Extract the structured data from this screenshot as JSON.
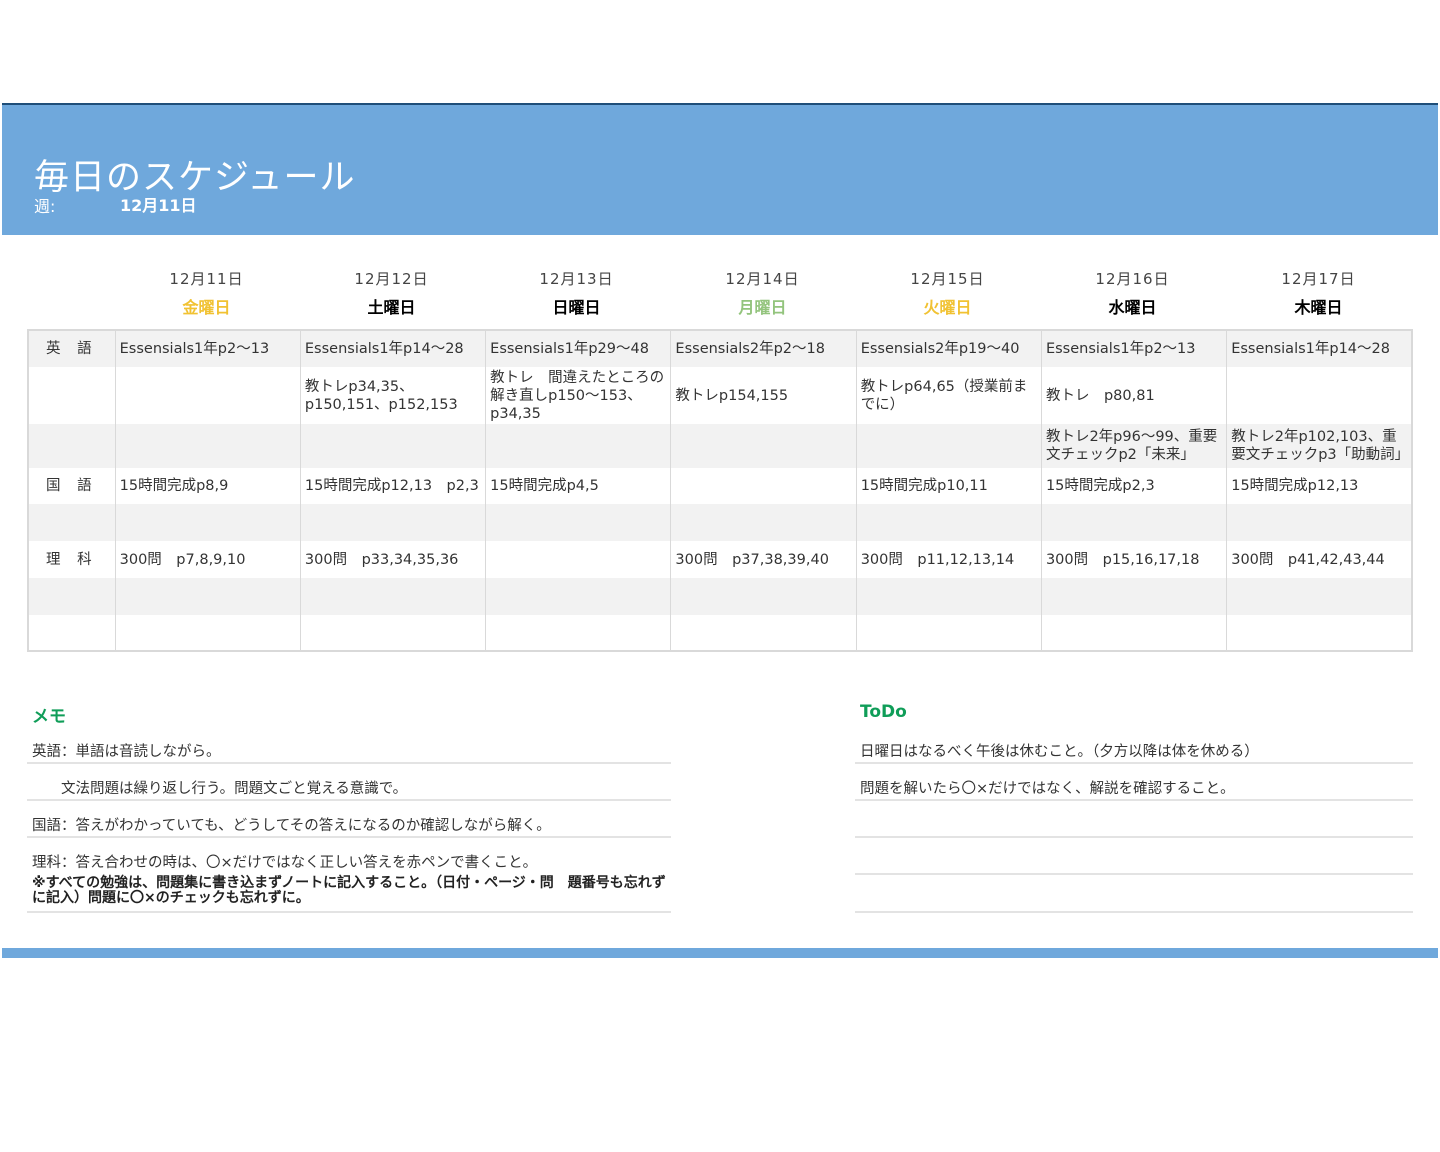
{
  "header": {
    "title": "毎日のスケジュール",
    "week_label": "週:",
    "week_value": "12月11日"
  },
  "days": [
    {
      "date": "12月11日",
      "name": "金曜日",
      "color": "#f1c232"
    },
    {
      "date": "12月12日",
      "name": "土曜日",
      "color": "#000000"
    },
    {
      "date": "12月13日",
      "name": "日曜日",
      "color": "#000000"
    },
    {
      "date": "12月14日",
      "name": "月曜日",
      "color": "#93c47d"
    },
    {
      "date": "12月15日",
      "name": "火曜日",
      "color": "#f1c232"
    },
    {
      "date": "12月16日",
      "name": "水曜日",
      "color": "#000000"
    },
    {
      "date": "12月17日",
      "name": "木曜日",
      "color": "#000000"
    }
  ],
  "rows": [
    {
      "subject": "英 語",
      "cells": [
        "Essensials1年p2～13",
        "Essensials1年p14～28",
        "Essensials1年p29～48",
        "Essensials2年p2～18",
        "Essensials2年p19～40",
        "Essensials1年p2～13",
        "Essensials1年p14～28"
      ]
    },
    {
      "subject": "",
      "cells": [
        "",
        "教トレp34,35、p150,151、p152,153",
        "教トレ　間違えたところの解き直しp150～153、p34,35",
        "教トレp154,155",
        "教トレp64,65（授業前までに）",
        "教トレ　p80,81",
        ""
      ]
    },
    {
      "subject": "",
      "cells": [
        "",
        "",
        "",
        "",
        "",
        "教トレ2年p96～99、重要文チェックp2「未来」",
        "教トレ2年p102,103、重要文チェックp3「助動詞」"
      ]
    },
    {
      "subject": "国 語",
      "cells": [
        "15時間完成p8,9",
        "15時間完成p12,13　p2,3",
        "15時間完成p4,5",
        "",
        "15時間完成p10,11",
        "15時間完成p2,3",
        "15時間完成p12,13"
      ]
    },
    {
      "subject": "",
      "cells": [
        "",
        "",
        "",
        "",
        "",
        "",
        ""
      ]
    },
    {
      "subject": "理 科",
      "cells": [
        "300問　p7,8,9,10",
        "300問　p33,34,35,36",
        "",
        "300問　p37,38,39,40",
        "300問　p11,12,13,14",
        "300問　p15,16,17,18",
        "300問　p41,42,43,44"
      ]
    },
    {
      "subject": "",
      "cells": [
        "",
        "",
        "",
        "",
        "",
        "",
        ""
      ]
    },
    {
      "subject": "",
      "cells": [
        "",
        "",
        "",
        "",
        "",
        "",
        ""
      ]
    }
  ],
  "memo": {
    "title": "メモ",
    "lines": [
      "英語：単語は音読しながら。",
      "　　文法問題は繰り返し行う。問題文ごと覚える意識で。",
      "国語：答えがわかっていても、どうしてその答えになるのか確認しながら解く。",
      "理科：答え合わせの時は、〇×だけではなく正しい答えを赤ペンで書くこと。"
    ],
    "bold_note": "※すべての勉強は、問題集に書き込まずノートに記入すること。（日付・ページ・問　題番号も忘れずに記入）問題に〇×のチェックも忘れずに。"
  },
  "todo": {
    "title": "ToDo",
    "lines": [
      "日曜日はなるべく午後は休むこと。（夕方以降は体を休める）",
      "問題を解いたら〇×だけではなく、解説を確認すること。",
      "",
      ""
    ]
  },
  "colors": {
    "header_band": "#6fa8dc",
    "heading_green": "#0f9d58",
    "row_shade": "#f2f2f2"
  }
}
